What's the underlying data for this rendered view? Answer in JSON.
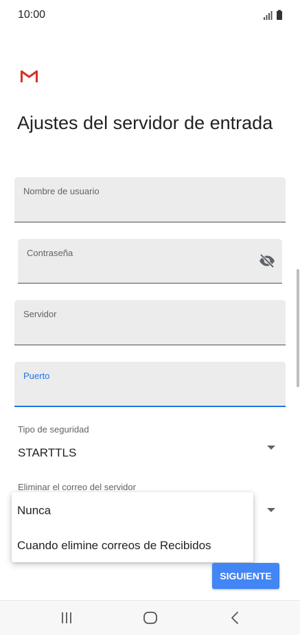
{
  "status_bar": {
    "time": "10:00"
  },
  "header": {
    "title": "Ajustes del servidor de entrada"
  },
  "fields": {
    "username": {
      "label": "Nombre de usuario",
      "value": ""
    },
    "password": {
      "label": "Contraseña",
      "value": ""
    },
    "server": {
      "label": "Servidor",
      "value": ""
    },
    "port": {
      "label": "Puerto",
      "value": ""
    }
  },
  "security": {
    "label": "Tipo de seguridad",
    "value": "STARTTLS"
  },
  "delete_mail": {
    "label": "Eliminar el correo del servidor",
    "options": [
      "Nunca",
      "Cuando elimine correos de Recibidos"
    ]
  },
  "buttons": {
    "next": "SIGUIENTE"
  },
  "icons": {
    "app_logo": "gmail-icon",
    "password_toggle": "visibility-off-icon",
    "nav_recents": "recents-icon",
    "nav_home": "home-icon",
    "nav_back": "back-icon"
  },
  "colors": {
    "accent": "#1a73e8",
    "button": "#4285f4",
    "gmail_red": "#d93025"
  }
}
